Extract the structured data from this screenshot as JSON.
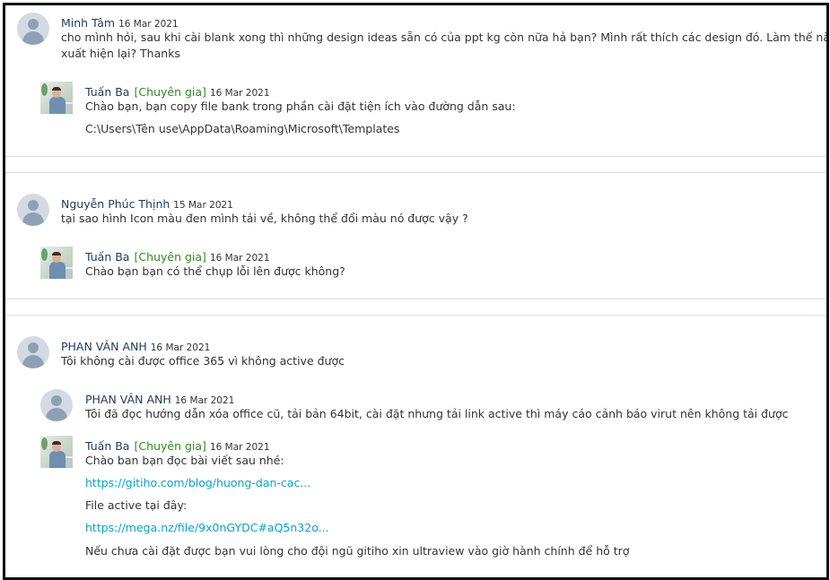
{
  "threads": [
    {
      "author": "Minh Tâm",
      "date": "16 Mar 2021",
      "text_line1": "cho mình hỏi, sau khi cài blank xong thì những design ideas sẵn có của ppt kg còn nữa hả bạn? Mình rất thích các design đó. Làm thế nào để nó",
      "text_line2": "xuất hiện lại? Thanks",
      "replies": [
        {
          "author": "Tuấn Ba",
          "badge": "[Chuyên gia]",
          "date": "16 Mar 2021",
          "line1": "Chào bạn, bạn copy file bank trong phần cài đặt tiện ích vào đường dẫn sau:",
          "line2": "C:\\Users\\Tên use\\AppData\\Roaming\\Microsoft\\Templates"
        }
      ]
    },
    {
      "author": "Nguyễn Phúc Thịnh",
      "date": "15 Mar 2021",
      "text_line1": "tại sao hình Icon màu đen mình tải về, không thể đổi màu nó được vậy ?",
      "replies": [
        {
          "author": "Tuấn Ba",
          "badge": "[Chuyên gia]",
          "date": "16 Mar 2021",
          "line1": "Chào bạn bạn có thể chụp lỗi lên được không?"
        }
      ]
    },
    {
      "author": "PHAN VÂN ANH",
      "date": "16 Mar 2021",
      "text_line1": "Tôi không cài được office 365 vì không active được",
      "replies": [
        {
          "author": "PHAN VÂN ANH",
          "date": "16 Mar 2021",
          "line1": "Tôi đã đọc hướng dẫn xóa office cũ, tải bản 64bit, cài đặt nhưng tải link active thì máy cáo cảnh báo virut nên không tải được"
        },
        {
          "author": "Tuấn Ba",
          "badge": "[Chuyên gia]",
          "date": "16 Mar 2021",
          "line1": "Chào ban bạn đọc bài viết sau nhé:",
          "link1": "https://gitiho.com/blog/huong-dan-cac...",
          "line2": "File active tại đây:",
          "link2": "https://mega.nz/file/9x0nGYDC#aQ5n32o...",
          "line3": "Nếu chưa cài đặt được bạn vui lòng cho đội ngũ gitiho xin ultraview vào giờ hành chính để hỗ trợ"
        }
      ]
    }
  ]
}
